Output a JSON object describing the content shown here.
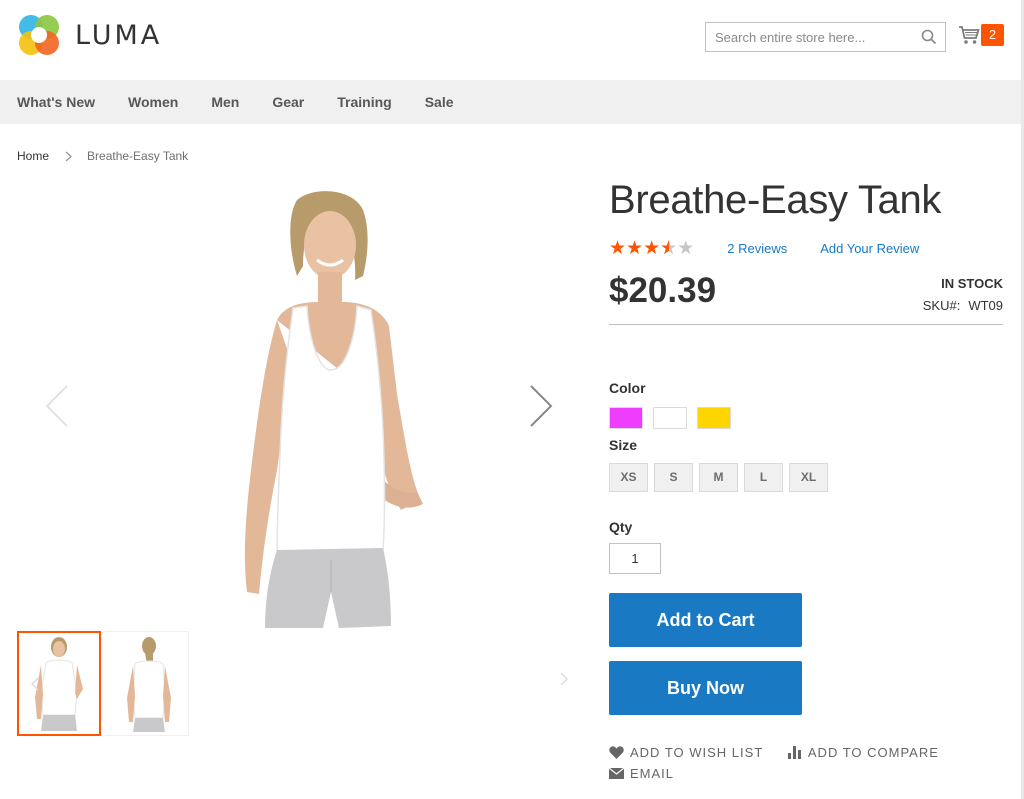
{
  "brand": {
    "name": "LUMA"
  },
  "search": {
    "placeholder": "Search entire store here..."
  },
  "cart": {
    "count": "2"
  },
  "nav": {
    "items": [
      "What's New",
      "Women",
      "Men",
      "Gear",
      "Training",
      "Sale"
    ]
  },
  "breadcrumb": {
    "home": "Home",
    "current": "Breathe-Easy Tank"
  },
  "product": {
    "title": "Breathe-Easy Tank",
    "rating": {
      "stars_filled": 3.5,
      "stars_total": 5
    },
    "reviews_label": "2 Reviews",
    "add_review_label": "Add Your Review",
    "price": "$20.39",
    "stock": "IN STOCK",
    "sku_label": "SKU#:",
    "sku": "WT09",
    "color_label": "Color",
    "colors": [
      "#ef3dff",
      "#ffffff",
      "#ffd500"
    ],
    "size_label": "Size",
    "sizes": [
      "XS",
      "S",
      "M",
      "L",
      "XL"
    ],
    "qty_label": "Qty",
    "qty": "1",
    "add_to_cart": "Add to Cart",
    "buy_now": "Buy Now",
    "wishlist": "ADD TO WISH LIST",
    "compare": "ADD TO COMPARE",
    "email": "EMAIL"
  },
  "colors": {
    "accent": "#1979c3",
    "brand_orange": "#ff5501",
    "nav_bg": "#f0f0f0"
  },
  "icons": [
    "luma-logo-icon",
    "search-icon",
    "cart-icon",
    "chevron-left-icon",
    "chevron-right-icon",
    "heart-icon",
    "bar-chart-icon",
    "envelope-icon"
  ]
}
